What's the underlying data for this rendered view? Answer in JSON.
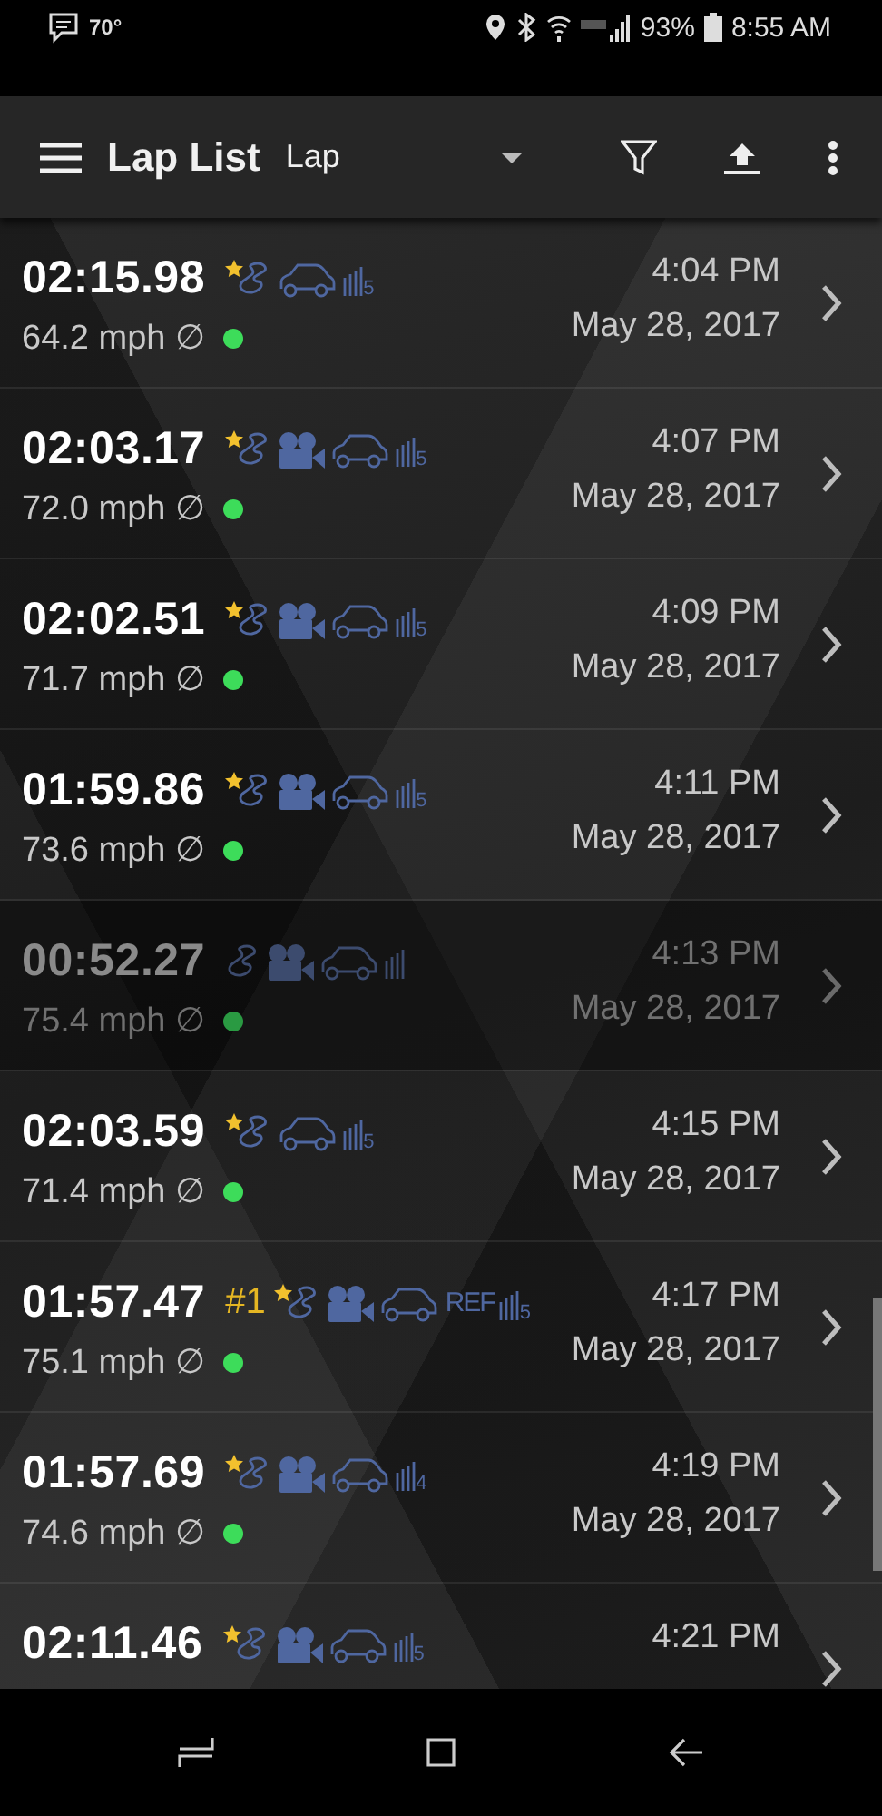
{
  "status_bar": {
    "temperature": "70°",
    "battery": "93%",
    "time": "8:55 AM"
  },
  "toolbar": {
    "title": "Lap List",
    "dropdown": "Lap"
  },
  "laps": [
    {
      "time": "02:15.98",
      "starred": true,
      "video": false,
      "ref": false,
      "signal": "5",
      "speed": "64.2 mph ∅",
      "color": "#3ddc5a",
      "clock": "4:04 PM",
      "date": "May 28, 2017",
      "disabled": false
    },
    {
      "time": "02:03.17",
      "starred": true,
      "video": true,
      "ref": false,
      "signal": "5",
      "speed": "72.0 mph ∅",
      "color": "#3ddc5a",
      "clock": "4:07 PM",
      "date": "May 28, 2017",
      "disabled": false
    },
    {
      "time": "02:02.51",
      "starred": true,
      "video": true,
      "ref": false,
      "signal": "5",
      "speed": "71.7 mph ∅",
      "color": "#3ddc5a",
      "clock": "4:09 PM",
      "date": "May 28, 2017",
      "disabled": false
    },
    {
      "time": "01:59.86",
      "starred": true,
      "video": true,
      "ref": false,
      "signal": "5",
      "speed": "73.6 mph ∅",
      "color": "#3ddc5a",
      "clock": "4:11 PM",
      "date": "May 28, 2017",
      "disabled": false
    },
    {
      "time": "00:52.27",
      "starred": false,
      "video": true,
      "ref": false,
      "speed": "75.4 mph ∅",
      "color": "#2a9a42",
      "clock": "4:13 PM",
      "date": "May 28, 2017",
      "disabled": true
    },
    {
      "time": "02:03.59",
      "starred": true,
      "video": false,
      "ref": false,
      "signal": "5",
      "speed": "71.4 mph ∅",
      "color": "#3ddc5a",
      "clock": "4:15 PM",
      "date": "May 28, 2017",
      "disabled": false
    },
    {
      "time": "01:57.47",
      "rank": "#1",
      "starred": true,
      "video": true,
      "ref": true,
      "ref_label": "REF",
      "signal": "5",
      "speed": "75.1 mph ∅",
      "color": "#3ddc5a",
      "clock": "4:17 PM",
      "date": "May 28, 2017",
      "disabled": false
    },
    {
      "time": "01:57.69",
      "starred": true,
      "video": true,
      "ref": false,
      "signal": "4",
      "speed": "74.6 mph ∅",
      "color": "#3ddc5a",
      "clock": "4:19 PM",
      "date": "May 28, 2017",
      "disabled": false
    },
    {
      "time": "02:11.46",
      "starred": true,
      "video": true,
      "ref": false,
      "signal": "5",
      "clock": "4:21 PM",
      "disabled": false
    }
  ]
}
